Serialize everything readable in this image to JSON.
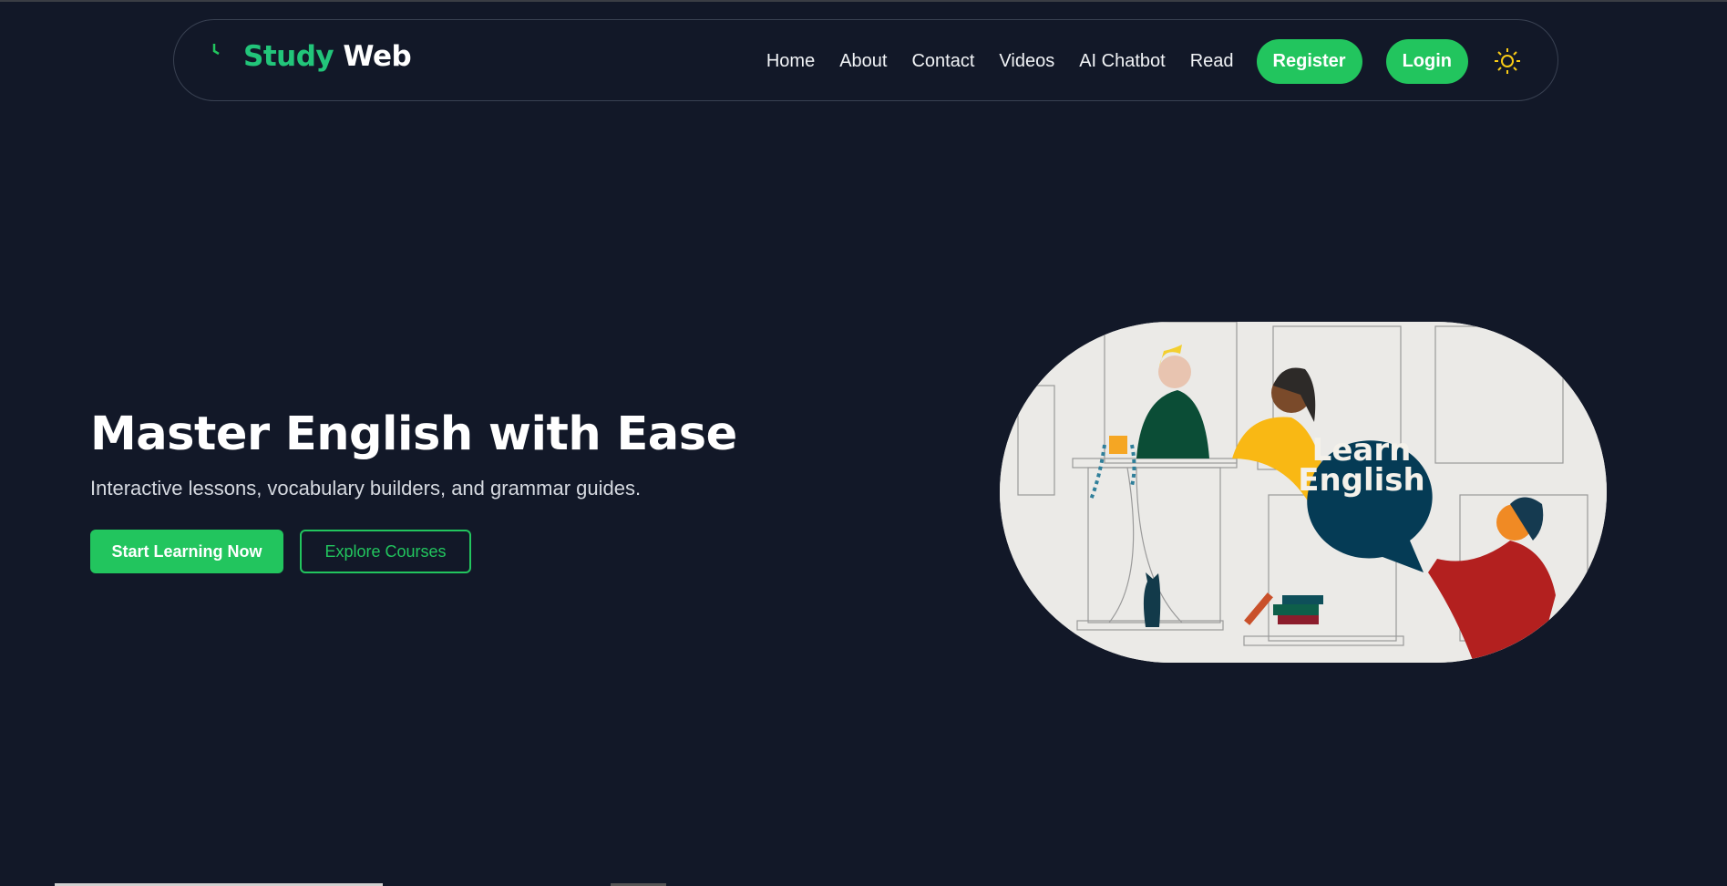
{
  "brand": {
    "part1": "Study",
    "part2": "Web",
    "accent": "#22c57a"
  },
  "nav": {
    "links": [
      "Home",
      "About",
      "Contact",
      "Videos",
      "AI Chatbot",
      "Read"
    ],
    "register_label": "Register",
    "login_label": "Login",
    "theme_icon": "sun-icon"
  },
  "hero": {
    "title": "Master English with Ease",
    "subtitle": "Interactive lessons, vocabulary builders, and grammar guides.",
    "primary_button": "Start Learning Now",
    "secondary_button": "Explore Courses",
    "image_text_line1": "Learn",
    "image_text_line2": "English"
  },
  "colors": {
    "background": "#121828",
    "button": "#22c55e",
    "bubble": "#053b55"
  }
}
